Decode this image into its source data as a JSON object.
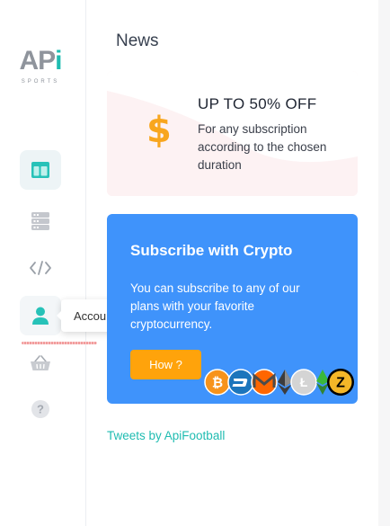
{
  "logo": {
    "word": "AP",
    "dot": "i",
    "sub": "SPORTS"
  },
  "sidebar": {
    "items": [
      {
        "name": "dashboard",
        "icon": "dashboard-icon",
        "active": true
      },
      {
        "name": "servers",
        "icon": "servers-icon",
        "active": false
      },
      {
        "name": "code",
        "icon": "code-icon",
        "active": false
      },
      {
        "name": "account",
        "icon": "user-icon",
        "active": false
      },
      {
        "name": "shop",
        "icon": "basket-icon",
        "active": false
      },
      {
        "name": "help",
        "icon": "question-icon",
        "active": false
      }
    ],
    "tooltip": "Account"
  },
  "main": {
    "title": "News",
    "promo": {
      "title": "UP TO 50% OFF",
      "text": "For any subscription according to the chosen duration",
      "icon": "dollar-icon"
    },
    "crypto": {
      "title": "Subscribe with Crypto",
      "text": "You can subscribe to any of our plans with your favorite cryptocurrency.",
      "button": "How ?",
      "coins": [
        "bitcoin-icon",
        "dash-icon",
        "monero-icon",
        "ethereum-icon",
        "litecoin-icon",
        "ethereum-classic-icon",
        "zcash-icon"
      ]
    },
    "tweets_link": "Tweets by ApiFootball"
  },
  "colors": {
    "accent": "#1fbcb1",
    "crypto_bg": "#3f93fb",
    "button": "#ffa30b",
    "promo_bg": "#fdf1f2"
  }
}
